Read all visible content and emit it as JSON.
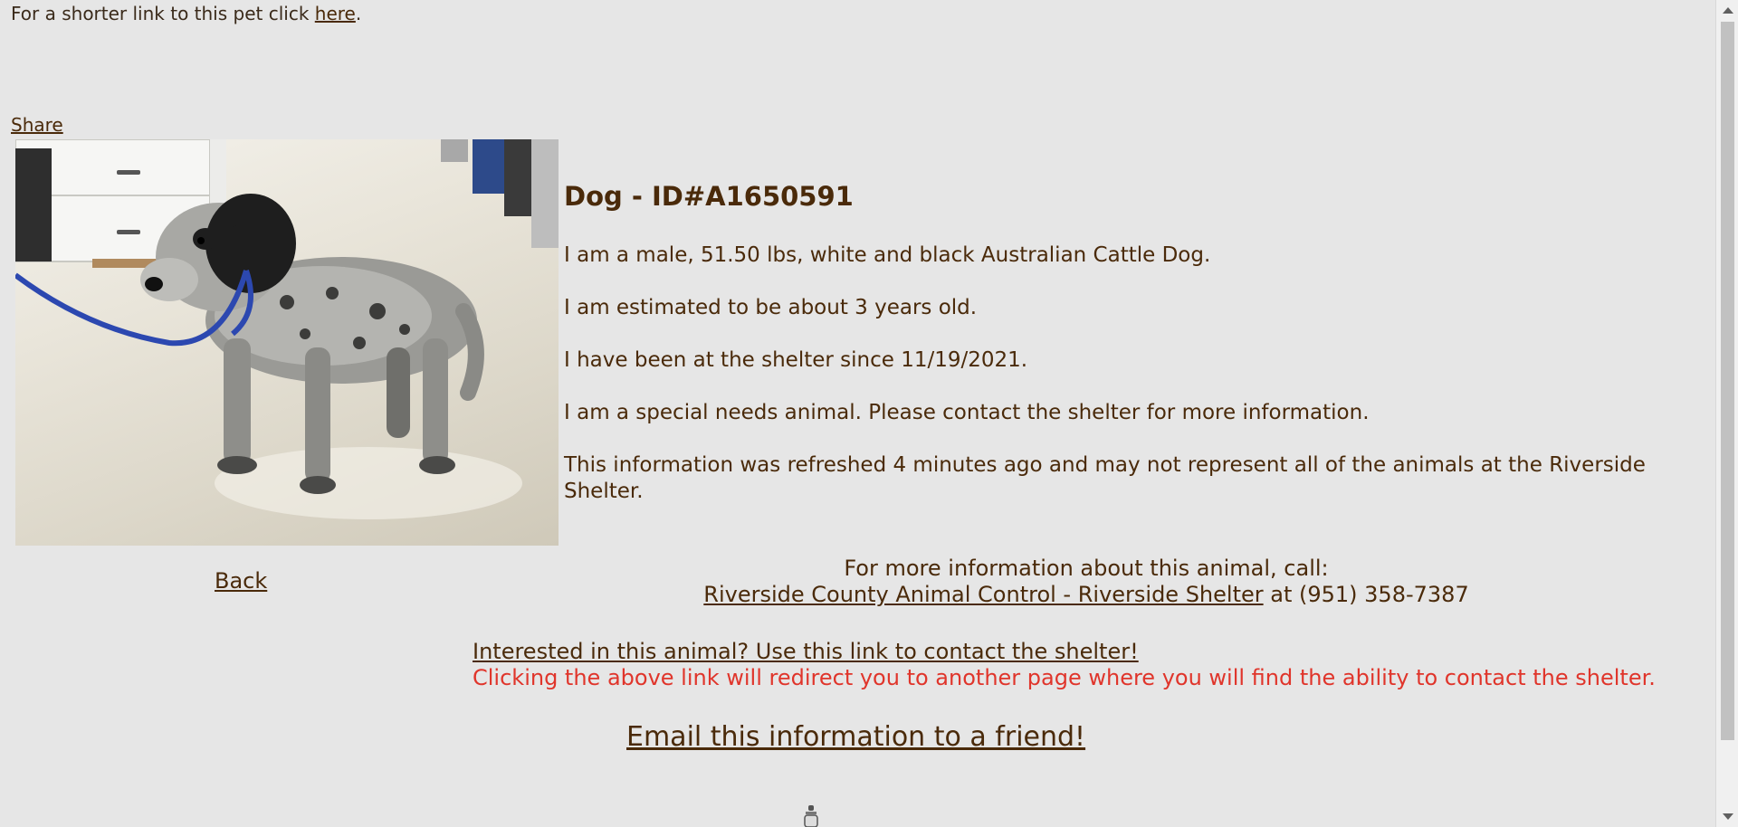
{
  "shortlink": {
    "prefix": "For a shorter link to this pet click ",
    "link_label": "here",
    "suffix": "."
  },
  "share_label": "Share",
  "pet": {
    "title": "Dog - ID#A1650591",
    "description": "I am a male, 51.50 lbs, white and black Australian Cattle Dog.",
    "age": "I am estimated to be about 3 years old.",
    "since": "I have been at the shelter since 11/19/2021.",
    "special_needs": "I am a special needs animal. Please contact the shelter for more information.",
    "refresh_note": "This information was refreshed 4 minutes ago and may not represent all of the animals at the Riverside Shelter."
  },
  "back_label": "Back",
  "contact": {
    "heading": "For more information about this animal, call:",
    "shelter_link": "Riverside County Animal Control - Riverside Shelter",
    "phone_text": " at (951) 358-7387"
  },
  "interest_link": "Interested in this animal? Use this link to contact the shelter!",
  "redirect_warning": "Clicking the above link will redirect you to another page where you will find the ability to contact the shelter.",
  "email_link": "Email this information to a friend!",
  "colors": {
    "background": "#e6e6e6",
    "text": "#4a2a0a",
    "warning": "#e0352b"
  }
}
